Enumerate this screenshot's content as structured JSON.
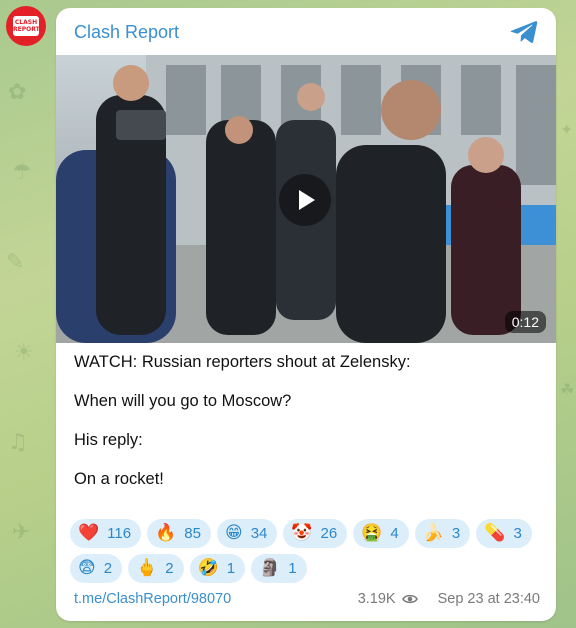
{
  "channel": {
    "name": "Clash Report",
    "avatar_text": "CLASH REPORT"
  },
  "video": {
    "duration": "0:12"
  },
  "message": {
    "lines": [
      "WATCH: Russian reporters shout at Zelensky:",
      "When will you go to Moscow?",
      "His reply:",
      "On a rocket!"
    ]
  },
  "reactions": [
    {
      "emoji": "❤️",
      "count": "116",
      "icon": "heart-icon"
    },
    {
      "emoji": "🔥",
      "count": "85",
      "icon": "fire-icon"
    },
    {
      "emoji": "😁",
      "count": "34",
      "icon": "grin-icon"
    },
    {
      "emoji": "🤡",
      "count": "26",
      "icon": "clown-icon"
    },
    {
      "emoji": "🤮",
      "count": "4",
      "icon": "vomit-icon"
    },
    {
      "emoji": "🍌",
      "count": "3",
      "icon": "banana-icon"
    },
    {
      "emoji": "💊",
      "count": "3",
      "icon": "pill-icon"
    },
    {
      "emoji": "😨",
      "count": "2",
      "icon": "fearful-icon"
    },
    {
      "emoji": "🖕",
      "count": "2",
      "icon": "middle-finger-icon"
    },
    {
      "emoji": "🤣",
      "count": "1",
      "icon": "rofl-icon"
    },
    {
      "emoji": "🗿",
      "count": "1",
      "icon": "moai-icon"
    }
  ],
  "footer": {
    "link": "t.me/ClashReport/98070",
    "views": "3.19K",
    "timestamp": "Sep 23 at 23:40"
  },
  "colors": {
    "accent": "#3a8fd0",
    "reaction_bg": "#ddeefb",
    "avatar": "#e31f28"
  }
}
